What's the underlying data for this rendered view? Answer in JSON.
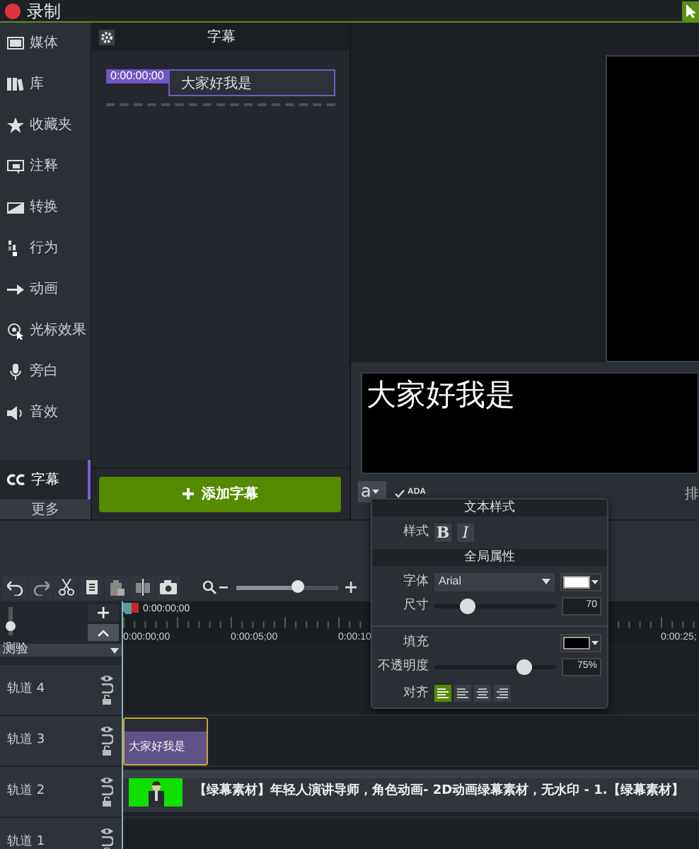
{
  "titlebar": {
    "record_label": "录制"
  },
  "sidebar": {
    "items": [
      {
        "label": "媒体",
        "selected": false
      },
      {
        "label": "库",
        "selected": false
      },
      {
        "label": "收藏夹",
        "selected": false
      },
      {
        "label": "注释",
        "selected": false
      },
      {
        "label": "转换",
        "selected": false
      },
      {
        "label": "行为",
        "selected": false
      },
      {
        "label": "动画",
        "selected": false
      },
      {
        "label": "光标效果",
        "selected": false
      },
      {
        "label": "旁白",
        "selected": false
      },
      {
        "label": "音效",
        "selected": false
      },
      {
        "label": "字幕",
        "selected": true
      }
    ],
    "more": "更多"
  },
  "captions_panel": {
    "title": "字幕",
    "captions": [
      {
        "time": "0:00:00;00",
        "text": "大家好我是",
        "selected": true
      }
    ],
    "add_button": "添加字幕"
  },
  "preview": {
    "caption_text": "大家好我是",
    "style_button": "a",
    "ada": {
      "label": "ADA",
      "checked": true
    },
    "right_label": "排"
  },
  "text_style_popup": {
    "title": "文本样式",
    "style_label": "样式",
    "bold": {
      "label": "B",
      "on": false
    },
    "italic": {
      "label": "I",
      "on": false
    },
    "section_title": "全局属性",
    "font": {
      "label": "字体",
      "value": "Arial",
      "color": "#ffffff"
    },
    "size": {
      "label": "尺寸",
      "level": 0.27,
      "value": "70"
    },
    "fill": {
      "label": "填充",
      "color": "#000000"
    },
    "opacity": {
      "label": "不透明度",
      "level": 0.73,
      "value": "75%"
    },
    "align": {
      "label": "对齐",
      "options": [
        {
          "selected": true
        },
        {
          "selected": false
        },
        {
          "selected": false
        },
        {
          "selected": false
        }
      ]
    }
  },
  "timeline": {
    "zoom": {
      "level": 0.6
    },
    "track_height": {
      "level": 0.2
    },
    "playhead_time": "0:00:00;00",
    "ruler_labels": [
      "0:00:00;00",
      "0:00:05;00",
      "0:00:10",
      "0:00:25;"
    ],
    "group": {
      "name": "测验"
    },
    "tracks": [
      {
        "name": "轨道 4"
      },
      {
        "name": "轨道 3",
        "clips": [
          {
            "kind": "caption",
            "text": "大家好我是",
            "selected": true
          }
        ]
      },
      {
        "name": "轨道 2",
        "clips": [
          {
            "kind": "media",
            "title": "【绿幕素材】年轻人演讲导师，角色动画- 2D动画绿幕素材，无水印 - 1.【绿幕素材】",
            "selected": false
          }
        ]
      },
      {
        "name": "轨道 1"
      }
    ]
  }
}
